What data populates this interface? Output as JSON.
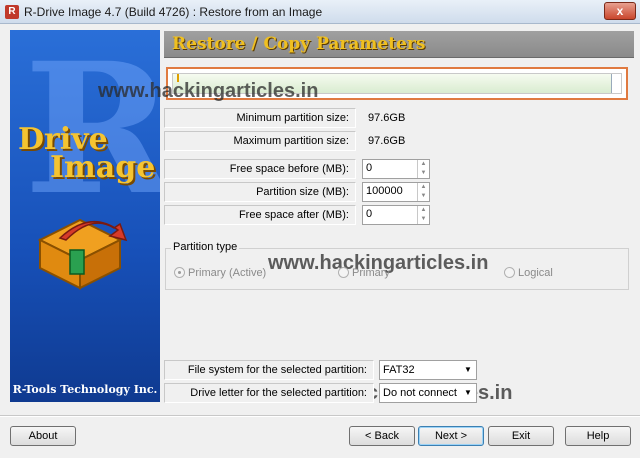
{
  "window": {
    "title": "R-Drive Image 4.7 (Build 4726) : Restore from an Image",
    "close_glyph": "x"
  },
  "banner": {
    "big_letter": "R",
    "line1": "Drive",
    "line2": "Image",
    "company": "R-Tools Technology Inc."
  },
  "header": {
    "title": "Restore / Copy Parameters"
  },
  "watermark": "www.hackingarticles.in",
  "progress": {
    "fill_fraction": 0.98
  },
  "fields": {
    "min_label": "Minimum partition size:",
    "min_value": "97.6GB",
    "max_label": "Maximum partition size:",
    "max_value": "97.6GB",
    "free_before_label": "Free space before (MB):",
    "free_before_value": "0",
    "partition_size_label": "Partition size (MB):",
    "partition_size_value": "100000",
    "free_after_label": "Free space after (MB):",
    "free_after_value": "0"
  },
  "partition_type": {
    "legend": "Partition type",
    "primary_active": "Primary (Active)",
    "primary": "Primary",
    "logical": "Logical"
  },
  "filesystem": {
    "label": "File system for the selected partition:",
    "value": "FAT32"
  },
  "drive_letter": {
    "label": "Drive letter for the selected partition:",
    "value": "Do not connect"
  },
  "buttons": {
    "about": "About",
    "back": "< Back",
    "next": "Next >",
    "exit": "Exit",
    "help": "Help"
  },
  "icons": {
    "spin_up": "▲",
    "spin_down": "▼",
    "dropdown": "▼"
  },
  "colors": {
    "banner_blue": "#1750b8",
    "header_gold": "#f0c020",
    "progress_border": "#e07a40"
  }
}
